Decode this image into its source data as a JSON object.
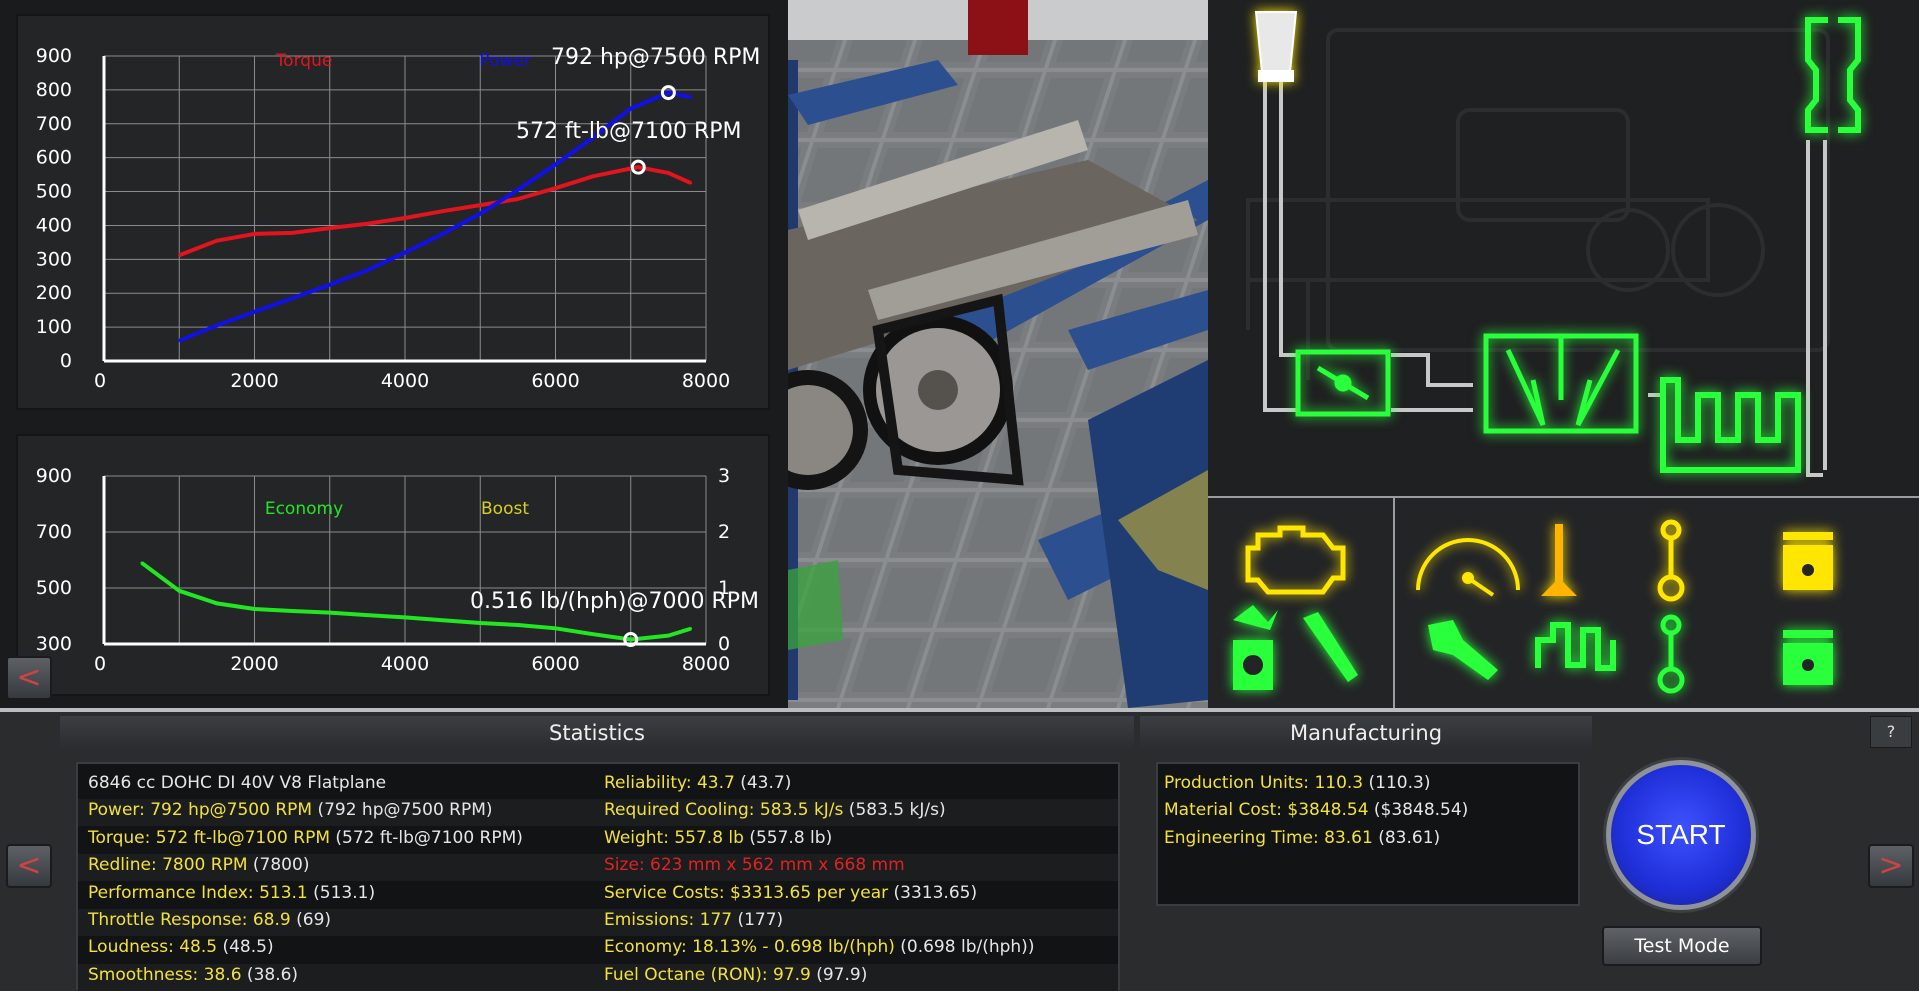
{
  "charts": {
    "power_label": "792 hp@7500 RPM",
    "torque_label": "572 ft-lb@7100 RPM",
    "economy_label": "0.516 lb/(hph)@7000 RPM"
  },
  "chart_data": [
    {
      "type": "line",
      "x_ticks": [
        "0",
        "2000",
        "4000",
        "6000",
        "8000"
      ],
      "y_ticks": [
        "0",
        "100",
        "200",
        "300",
        "400",
        "500",
        "600",
        "700",
        "800",
        "900"
      ],
      "xlim": [
        0,
        8000
      ],
      "ylim": [
        0,
        900
      ],
      "grid": true,
      "legend": "top",
      "annotations": [
        "792 hp@7500 RPM",
        "572 ft-lb@7100 RPM"
      ],
      "series": [
        {
          "name": "Torque",
          "color": "#e3141e",
          "x": [
            1000,
            1500,
            2000,
            2500,
            3000,
            3500,
            4000,
            4500,
            5000,
            5500,
            6000,
            6500,
            7000,
            7100,
            7500,
            7800
          ],
          "values": [
            312,
            355,
            375,
            378,
            392,
            405,
            422,
            442,
            460,
            478,
            510,
            545,
            568,
            572,
            555,
            525
          ]
        },
        {
          "name": "Power",
          "color": "#1010e8",
          "x": [
            1000,
            1500,
            2000,
            2500,
            3000,
            3500,
            4000,
            4500,
            5000,
            5500,
            6000,
            6500,
            7000,
            7500,
            7800
          ],
          "values": [
            60,
            105,
            145,
            185,
            225,
            268,
            320,
            375,
            435,
            505,
            580,
            660,
            745,
            792,
            778
          ]
        }
      ]
    },
    {
      "type": "line",
      "x_ticks": [
        "0",
        "2000",
        "4000",
        "6000",
        "8000"
      ],
      "y_ticks": [
        "300",
        "500",
        "700",
        "900"
      ],
      "y2_ticks": [
        "0",
        "1",
        "2",
        "3"
      ],
      "xlim": [
        0,
        8000
      ],
      "ylim": [
        300,
        900
      ],
      "y2lim": [
        0,
        3
      ],
      "grid": true,
      "legend": "top",
      "annotations": [
        "0.516 lb/(hph)@7000 RPM"
      ],
      "series": [
        {
          "name": "Economy",
          "color": "#22e622",
          "x": [
            500,
            1000,
            1500,
            2000,
            2500,
            3000,
            3500,
            4000,
            4500,
            5000,
            5500,
            6000,
            6500,
            7000,
            7500,
            7800
          ],
          "values": [
            590,
            490,
            445,
            425,
            418,
            412,
            403,
            395,
            385,
            375,
            368,
            356,
            335,
            316,
            330,
            355
          ]
        },
        {
          "name": "Boost",
          "color": "#d8d020",
          "x": [],
          "values": []
        }
      ]
    }
  ],
  "statistics": {
    "title": "Statistics",
    "left": [
      [
        {
          "t": "6846 cc DOHC DI 40V V8 Flatplane",
          "c": "w"
        }
      ],
      [
        {
          "t": "Power: 792 hp@7500 RPM",
          "c": "y"
        },
        {
          "t": " (792 hp@7500 RPM)",
          "c": "w"
        }
      ],
      [
        {
          "t": "Torque: 572 ft-lb@7100 RPM",
          "c": "y"
        },
        {
          "t": " (572 ft-lb@7100 RPM)",
          "c": "w"
        }
      ],
      [
        {
          "t": "Redline: 7800 RPM",
          "c": "y"
        },
        {
          "t": " (7800)",
          "c": "w"
        }
      ],
      [
        {
          "t": "Performance Index: 513.1",
          "c": "y"
        },
        {
          "t": " (513.1)",
          "c": "w"
        }
      ],
      [
        {
          "t": "Throttle Response: 68.9",
          "c": "y"
        },
        {
          "t": " (69)",
          "c": "w"
        }
      ],
      [
        {
          "t": "Loudness: 48.5",
          "c": "y"
        },
        {
          "t": " (48.5)",
          "c": "w"
        }
      ],
      [
        {
          "t": "Smoothness: 38.6",
          "c": "y"
        },
        {
          "t": " (38.6)",
          "c": "w"
        }
      ]
    ],
    "right": [
      [
        {
          "t": "Reliability: 43.7",
          "c": "y"
        },
        {
          "t": " (43.7)",
          "c": "w"
        }
      ],
      [
        {
          "t": "Required Cooling: 583.5 kJ/s",
          "c": "y"
        },
        {
          "t": " (583.5 kJ/s)",
          "c": "w"
        }
      ],
      [
        {
          "t": "Weight: 557.8 lb",
          "c": "y"
        },
        {
          "t": " (557.8 lb)",
          "c": "w"
        }
      ],
      [
        {
          "t": "Size: 623 mm x 562 mm x 668 mm",
          "c": "r"
        }
      ],
      [
        {
          "t": "Service Costs: $3313.65 per year",
          "c": "y"
        },
        {
          "t": " (3313.65)",
          "c": "w"
        }
      ],
      [
        {
          "t": "Emissions: 177",
          "c": "y"
        },
        {
          "t": " (177)",
          "c": "w"
        }
      ],
      [
        {
          "t": "Economy: 18.13% - 0.698 lb/(hph)",
          "c": "y"
        },
        {
          "t": " (0.698 lb/(hph))",
          "c": "w"
        }
      ],
      [
        {
          "t": "Fuel Octane (RON): 97.9",
          "c": "y"
        },
        {
          "t": " (97.9)",
          "c": "w"
        }
      ]
    ]
  },
  "manufacturing": {
    "title": "Manufacturing",
    "rows": [
      [
        {
          "t": "Production Units: 110.3",
          "c": "y"
        },
        {
          "t": " (110.3)",
          "c": "w"
        }
      ],
      [
        {
          "t": "Material Cost: $3848.54",
          "c": "y"
        },
        {
          "t": " ($3848.54)",
          "c": "w"
        }
      ],
      [
        {
          "t": "Engineering Time: 83.61",
          "c": "y"
        },
        {
          "t": " (83.61)",
          "c": "w"
        }
      ]
    ]
  },
  "buttons": {
    "start": "START",
    "test_mode": "Test Mode",
    "help": "?",
    "back": "<",
    "prev": "<",
    "next": ">"
  },
  "colors": {
    "stat_yellow": "#f2e23a",
    "stat_red": "#e02222",
    "icon_yellow": "#ffe600",
    "icon_green": "#29ff3a"
  }
}
